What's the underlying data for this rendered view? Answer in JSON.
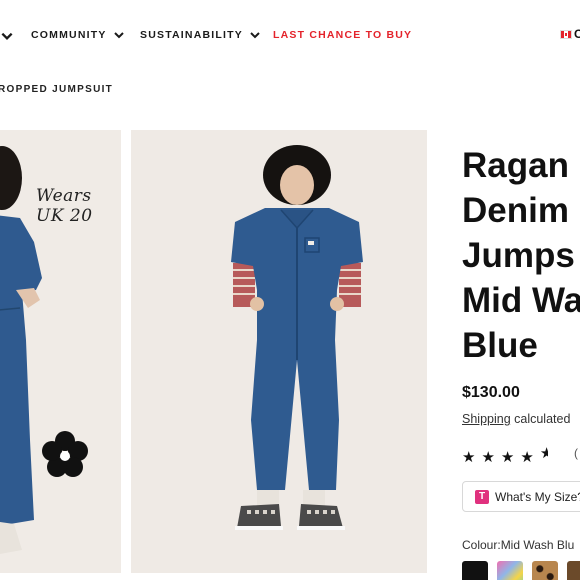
{
  "nav": {
    "items": [
      {
        "label": "COMMUNITY"
      },
      {
        "label": "SUSTAINABILITY"
      },
      {
        "label": "LAST CHANCE TO BUY"
      }
    ],
    "locale_label": "C",
    "sale_color": "#e4232b"
  },
  "breadcrumb": {
    "current": "ROPPED JUMPSUIT"
  },
  "gallery": {
    "size_note_line1": "Wears",
    "size_note_line2": "UK 20"
  },
  "product": {
    "title_lines": [
      "Ragan",
      "Denim",
      "Jumps",
      "Mid Wa",
      "Blue"
    ],
    "price": "$130.00",
    "shipping_link": "Shipping",
    "shipping_text": " calculated",
    "rating_stars": 4.5,
    "review_count_fragment": "(",
    "size_button_label": "What's My Size?",
    "size_button_icon": "T",
    "colour_label": "Colour:",
    "colour_value": "Mid Wash Blu"
  },
  "swatches": [
    {
      "name": "black",
      "color": "#111111"
    },
    {
      "name": "multicolour",
      "color": "#8fb6e8"
    },
    {
      "name": "leopard",
      "color": "#8a5a2b"
    },
    {
      "name": "brown",
      "color": "#6b4a2a"
    }
  ]
}
